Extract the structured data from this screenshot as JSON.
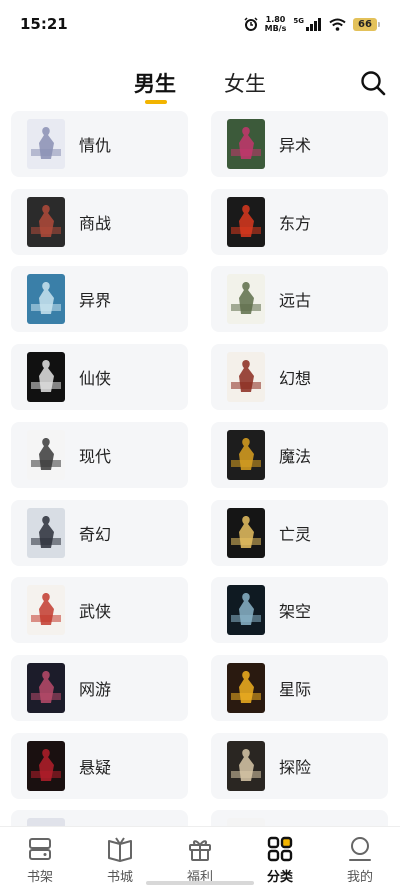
{
  "status_bar": {
    "time": "15:21",
    "speed_value": "1.80",
    "speed_unit": "MB/s",
    "network": "5G",
    "battery": "66"
  },
  "tabs": {
    "male": "男生",
    "female": "女生",
    "active": "male"
  },
  "categories": [
    {
      "label": "情仇",
      "cover_colors": [
        "#e8eaf2",
        "#8a8fb4"
      ]
    },
    {
      "label": "异术",
      "cover_colors": [
        "#3c5a3a",
        "#c3366d"
      ]
    },
    {
      "label": "商战",
      "cover_colors": [
        "#2b2b2b",
        "#b04a3a"
      ]
    },
    {
      "label": "东方",
      "cover_colors": [
        "#1a1a1a",
        "#d9381e"
      ]
    },
    {
      "label": "异界",
      "cover_colors": [
        "#3a7fa8",
        "#c9e3ee"
      ]
    },
    {
      "label": "远古",
      "cover_colors": [
        "#f2f2ea",
        "#5e6e4a"
      ]
    },
    {
      "label": "仙侠",
      "cover_colors": [
        "#111111",
        "#e4e4e4"
      ]
    },
    {
      "label": "幻想",
      "cover_colors": [
        "#f4f0ea",
        "#8a2a1e"
      ]
    },
    {
      "label": "现代",
      "cover_colors": [
        "#f5f5f5",
        "#3a3a3a"
      ]
    },
    {
      "label": "魔法",
      "cover_colors": [
        "#1d1d1d",
        "#d9a020"
      ]
    },
    {
      "label": "奇幻",
      "cover_colors": [
        "#d8dde4",
        "#2c2f3a"
      ]
    },
    {
      "label": "亡灵",
      "cover_colors": [
        "#151515",
        "#e6c060"
      ]
    },
    {
      "label": "武侠",
      "cover_colors": [
        "#f5f2ee",
        "#c23b2e"
      ]
    },
    {
      "label": "架空",
      "cover_colors": [
        "#0f1a22",
        "#8ab4c8"
      ]
    },
    {
      "label": "网游",
      "cover_colors": [
        "#1c1c2a",
        "#b84a6a"
      ]
    },
    {
      "label": "星际",
      "cover_colors": [
        "#2a1a10",
        "#f0b020"
      ]
    },
    {
      "label": "悬疑",
      "cover_colors": [
        "#1a1010",
        "#b41e2a"
      ]
    },
    {
      "label": "探险",
      "cover_colors": [
        "#2a2622",
        "#d8c8a8"
      ]
    },
    {
      "label": "",
      "cover_colors": [
        "#e0e2ea",
        "#8a8fb4"
      ]
    },
    {
      "label": "",
      "cover_colors": [
        "#f4f4f4",
        "#222222"
      ]
    }
  ],
  "bottom_nav": [
    {
      "label": "书架",
      "icon": "bookshelf-icon"
    },
    {
      "label": "书城",
      "icon": "book-store-icon"
    },
    {
      "label": "福利",
      "icon": "gift-icon"
    },
    {
      "label": "分类",
      "icon": "category-grid-icon",
      "active": true
    },
    {
      "label": "我的",
      "icon": "profile-icon"
    }
  ],
  "colors": {
    "accent": "#f2b400",
    "card_bg": "#f5f6f8",
    "text": "#222222"
  }
}
